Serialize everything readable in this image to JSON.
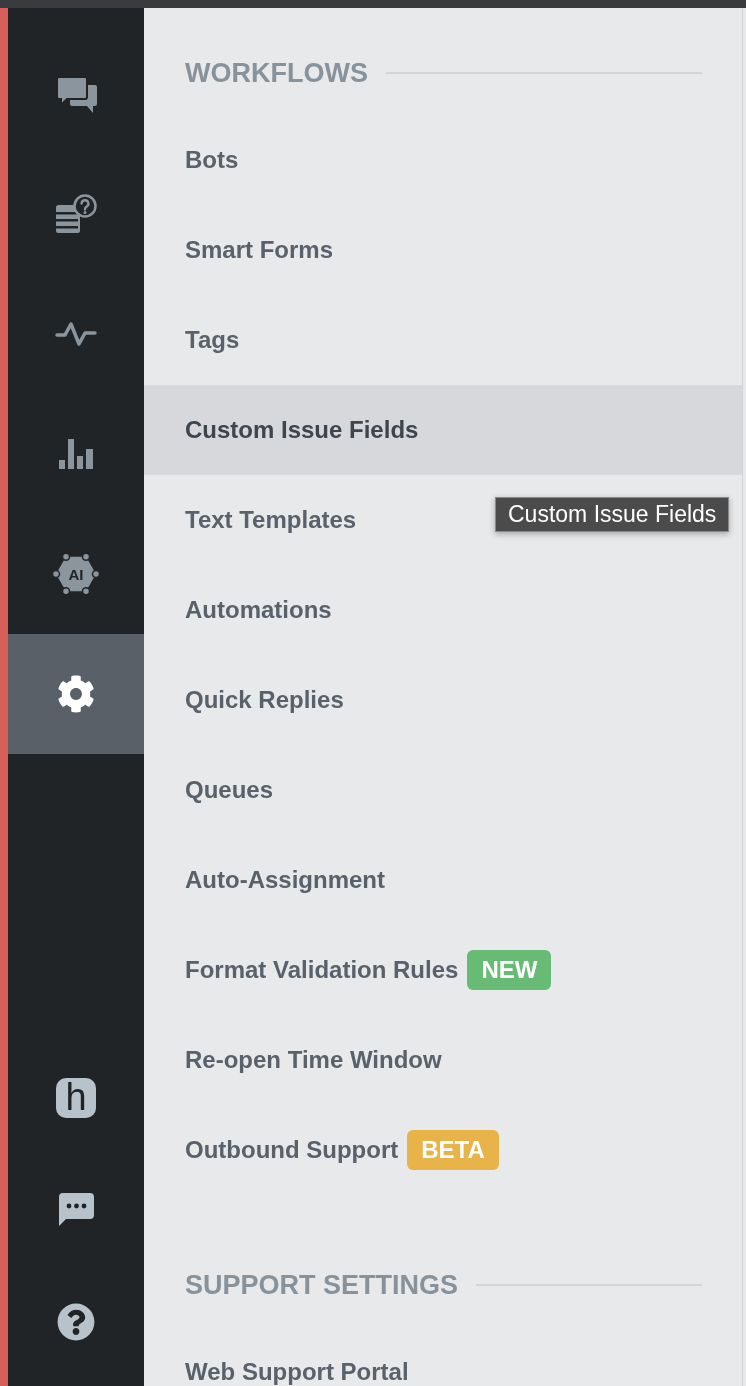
{
  "sidebar": {
    "items": [
      {
        "selected": false
      },
      {
        "selected": false
      },
      {
        "selected": false
      },
      {
        "selected": false
      },
      {
        "selected": false,
        "label": "AI"
      },
      {
        "selected": true
      }
    ],
    "footer_logo": "h"
  },
  "sections": [
    {
      "title": "WORKFLOWS",
      "items": [
        {
          "label": "Bots",
          "hovered": false
        },
        {
          "label": "Smart Forms",
          "hovered": false
        },
        {
          "label": "Tags",
          "hovered": false
        },
        {
          "label": "Custom Issue Fields",
          "hovered": true
        },
        {
          "label": "Text Templates",
          "hovered": false
        },
        {
          "label": "Automations",
          "hovered": false
        },
        {
          "label": "Quick Replies",
          "hovered": false
        },
        {
          "label": "Queues",
          "hovered": false
        },
        {
          "label": "Auto-Assignment",
          "hovered": false
        },
        {
          "label": "Format Validation Rules",
          "hovered": false,
          "badge": {
            "text": "NEW",
            "color": "#68bb74"
          }
        },
        {
          "label": "Re-open Time Window",
          "hovered": false
        },
        {
          "label": "Outbound Support",
          "hovered": false,
          "badge": {
            "text": "BETA",
            "color": "#e8b349"
          }
        }
      ]
    },
    {
      "title": "SUPPORT SETTINGS",
      "items": [
        {
          "label": "Web Support Portal",
          "hovered": false
        }
      ]
    }
  ],
  "tooltip": {
    "text": "Custom Issue Fields"
  }
}
